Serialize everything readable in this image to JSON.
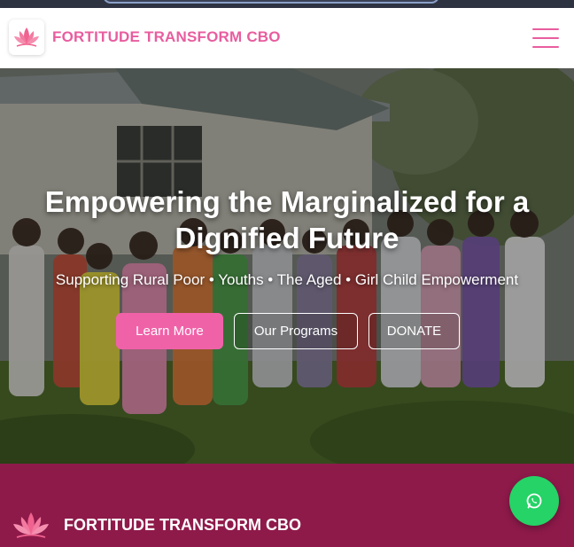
{
  "brand": {
    "name": "FORTITUDE TRANSFORM CBO",
    "logo_icon": "lotus-icon",
    "color": "#e85d9f"
  },
  "navbar": {
    "menu_icon": "hamburger-menu-icon"
  },
  "hero": {
    "title": "Empowering the Marginalized for a Dignified Future",
    "subtitle": "Supporting Rural Poor • Youths • The Aged • Girl Child Empowerment",
    "buttons": {
      "learn_more": "Learn More",
      "our_programs": "Our Programs",
      "donate": "DONATE"
    }
  },
  "footer": {
    "name": "FORTITUDE TRANSFORM CBO",
    "background": "#8e1a4a"
  },
  "floating": {
    "whatsapp_icon": "whatsapp-icon",
    "color": "#25d366"
  }
}
